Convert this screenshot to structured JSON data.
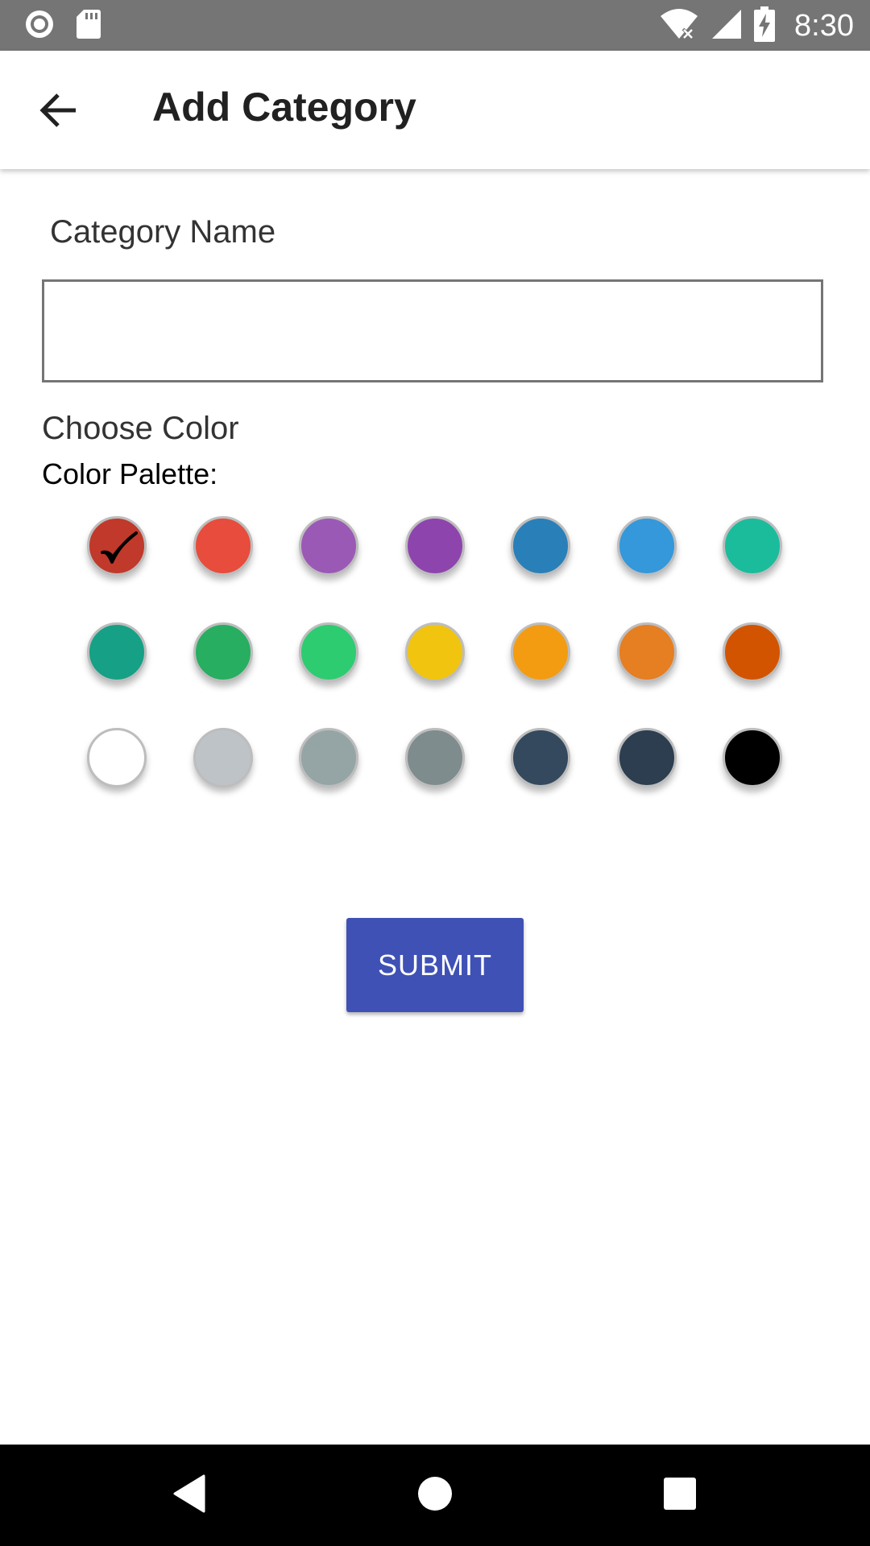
{
  "status_bar": {
    "time": "8:30",
    "icons": [
      "record-icon",
      "sd-card-icon",
      "wifi-icon",
      "signal-icon",
      "battery-charging-icon"
    ]
  },
  "app_bar": {
    "back_icon": "arrow-left-icon",
    "title": "Add Category"
  },
  "form": {
    "name_label": "Category Name",
    "name_value": "",
    "name_placeholder": "",
    "choose_color_label": "Choose Color",
    "palette_label": "Color Palette:",
    "selected_index": 0,
    "colors": [
      "#c0392b",
      "#e74c3c",
      "#9b59b6",
      "#8e44ad",
      "#2980b9",
      "#3498db",
      "#1abc9c",
      "#16a085",
      "#27ae60",
      "#2ecc71",
      "#f1c40f",
      "#f39c12",
      "#e67e22",
      "#d35400",
      "#ffffff",
      "#bdc3c7",
      "#95a5a6",
      "#7f8c8d",
      "#34495e",
      "#2c3e50",
      "#000000"
    ],
    "submit_label": "SUBMIT"
  },
  "nav_bar": {
    "buttons": [
      "back-triangle-icon",
      "home-circle-icon",
      "recents-square-icon"
    ]
  },
  "theme": {
    "status_bar_color": "#757575",
    "primary_color": "#3f51b5"
  }
}
